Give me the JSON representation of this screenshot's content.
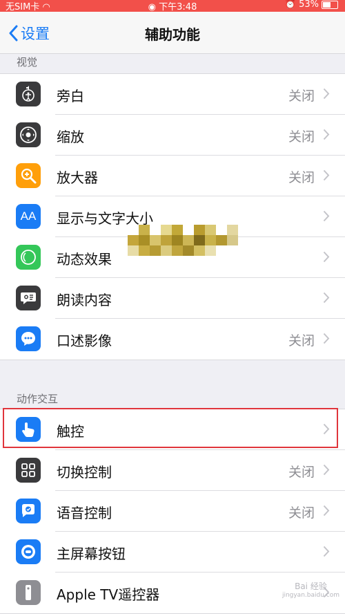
{
  "status_bar": {
    "carrier": "无SIM卡",
    "time": "下午3:48",
    "battery": "53%"
  },
  "nav": {
    "back_label": "设置",
    "title": "辅助功能"
  },
  "sections": {
    "vision": {
      "header": "视觉",
      "items": [
        {
          "label": "旁白",
          "value": "关闭",
          "icon": "voiceover-icon",
          "color": "#3a3a3c"
        },
        {
          "label": "缩放",
          "value": "关闭",
          "icon": "zoom-icon",
          "color": "#3a3a3c"
        },
        {
          "label": "放大器",
          "value": "关闭",
          "icon": "magnifier-icon",
          "color": "#ff9f0a"
        },
        {
          "label": "显示与文字大小",
          "value": "",
          "icon": "text-size-icon",
          "color": "#1a7cf5"
        },
        {
          "label": "动态效果",
          "value": "",
          "icon": "motion-icon",
          "color": "#34c759"
        },
        {
          "label": "朗读内容",
          "value": "",
          "icon": "speech-icon",
          "color": "#3a3a3c"
        },
        {
          "label": "口述影像",
          "value": "关闭",
          "icon": "audio-description-icon",
          "color": "#1a7cf5"
        }
      ]
    },
    "interaction": {
      "header": "动作交互",
      "items": [
        {
          "label": "触控",
          "value": "",
          "icon": "touch-icon",
          "color": "#1a7cf5"
        },
        {
          "label": "切换控制",
          "value": "关闭",
          "icon": "switch-control-icon",
          "color": "#3a3a3c"
        },
        {
          "label": "语音控制",
          "value": "关闭",
          "icon": "voice-control-icon",
          "color": "#1a7cf5"
        },
        {
          "label": "主屏幕按钮",
          "value": "",
          "icon": "home-button-icon",
          "color": "#1a7cf5"
        },
        {
          "label": "Apple TV遥控器",
          "value": "",
          "icon": "remote-icon",
          "color": "#8e8e93"
        }
      ]
    }
  },
  "watermark": {
    "line1": "Bai 经验",
    "line2": "jingyan.baidu.com"
  }
}
